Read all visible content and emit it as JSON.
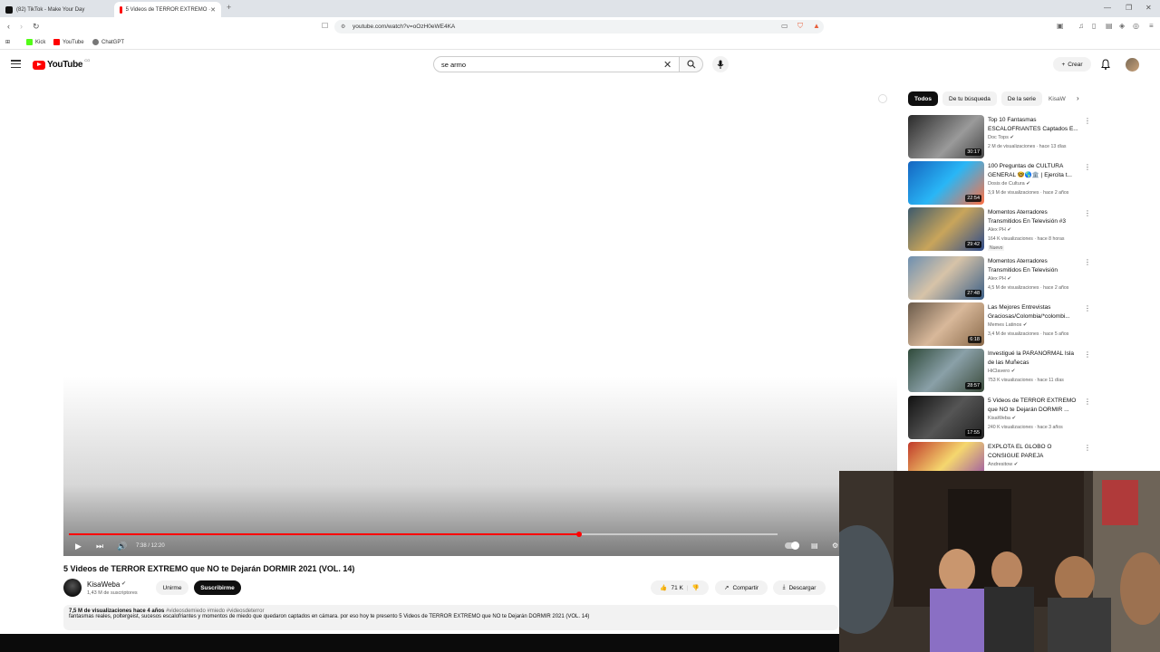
{
  "browser": {
    "tabs": [
      {
        "label": "(82) TikTok - Make Your Day",
        "color": "#111111"
      },
      {
        "label": "5 Videos de TERROR EXTREMO ·",
        "color": "#ff0000"
      }
    ],
    "new_tab": "+",
    "url": "youtube.com/watch?v=oOzH0eWE4KA",
    "bookmarks": [
      {
        "label": "Kick",
        "color": "#53fc18"
      },
      {
        "label": "YouTube",
        "color": "#ff0000"
      },
      {
        "label": "ChatGPT",
        "color": "#777777"
      }
    ]
  },
  "yt": {
    "logo_text": "YouTube",
    "country": "CO",
    "search_value": "se armo",
    "create_label": "Crear"
  },
  "player": {
    "progress_fraction": 0.72,
    "time": "7:38 / 12:20"
  },
  "video": {
    "title": "5 Videos de TERROR EXTREMO que NO te Dejarán DORMIR 2021 (VOL. 14)",
    "channel": "KisaWeba",
    "subs": "1,43 M de suscriptores",
    "join_label": "Unirme",
    "subscribe_label": "Suscribirme",
    "likes": "71 K",
    "share_label": "Compartir",
    "download_label": "Descargar",
    "views": "7,5 M de visualizaciones",
    "age": "hace 4 años",
    "tags": "#videosdemiedo #miedo #videosdeterror",
    "description": "fantasmas reales, poltergeist, sucesos escalofriantes y momentos de miedo que quedaron captados en cámara. por eso hoy te presento 5 Videos de TERROR EXTREMO que NO te Dejarán DORMIR 2021 (VOL. 14)"
  },
  "chips": [
    "Todos",
    "De tu búsqueda",
    "De la serie",
    "KisaW"
  ],
  "recommendations": [
    {
      "title": "Top 10 Fantasmas ESCALOFRIANTES Captados E...",
      "channel": "Doc Tops",
      "meta": "2 M de visualizaciones · hace 13 días",
      "duration": "30:17",
      "badge": "",
      "thumb": "linear-gradient(135deg,#2a2a2a,#9a9a9a 60%,#444)"
    },
    {
      "title": "100 Preguntas de CULTURA GENERAL 🤓🌎🏛️ | Ejercita t...",
      "channel": "Dosis de Cultura",
      "meta": "3,9 M de visualizaciones · hace 2 años",
      "duration": "22:54",
      "badge": "",
      "thumb": "linear-gradient(135deg,#1565c0,#29b6f6 50%,#ff7043)"
    },
    {
      "title": "Momentos Aterradores Transmitidos En Televisión #3",
      "channel": "Alex PH",
      "meta": "164 K visualizaciones · hace 8 horas",
      "duration": "29:42",
      "badge": "Nuevo",
      "thumb": "linear-gradient(135deg,#3d5a6c,#c9a55b 50%,#2e4b8a)"
    },
    {
      "title": "Momentos Aterradores Transmitidos En Televisión",
      "channel": "Alex PH",
      "meta": "4,5 M de visualizaciones · hace 2 años",
      "duration": "27:48",
      "badge": "",
      "thumb": "linear-gradient(135deg,#6d8fb0,#d7c3a8 45%,#3b5f87)"
    },
    {
      "title": "Las Mejores Entrevistas Graciosas/Colombia/*colombi...",
      "channel": "Memes Latinos",
      "meta": "3,4 M de visualizaciones · hace 5 años",
      "duration": "6:18",
      "badge": "",
      "thumb": "linear-gradient(135deg,#6a5a4a,#d8b89a 50%,#8a6a4a)"
    },
    {
      "title": "Investigué la PARANORMAL Isla de las Muñecas",
      "channel": "HiClavero",
      "meta": "753 K visualizaciones · hace 11 días",
      "duration": "28:57",
      "badge": "",
      "thumb": "linear-gradient(135deg,#2f4a3a,#8aa0a8 50%,#3a4a3a)"
    },
    {
      "title": "5 Videos de TERROR EXTREMO que NO te Dejarán DORMIR ...",
      "channel": "KisaWeba",
      "meta": "240 K visualizaciones · hace 3 años",
      "duration": "17:55",
      "badge": "",
      "thumb": "linear-gradient(135deg,#111,#555 50%,#222)"
    },
    {
      "title": "EXPLOTA EL GLOBO O CONSIGUE PAREJA",
      "channel": "Andresitow",
      "meta": "",
      "duration": "",
      "badge": "",
      "thumb": "linear-gradient(135deg,#c0392b,#f5d76e 50%,#8e44ad)"
    }
  ],
  "colors": {
    "accent": "#ff0000",
    "chip_active": "#0f0f0f"
  }
}
